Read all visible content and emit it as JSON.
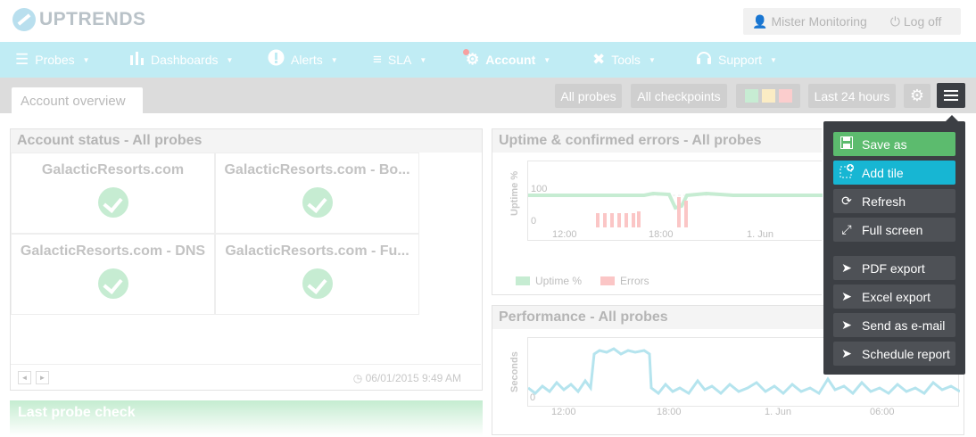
{
  "app": {
    "brand": "UPTRENDS"
  },
  "user": {
    "name": "Mister Monitoring",
    "logoff": "Log off"
  },
  "nav": [
    {
      "label": "Probes",
      "icon": "list-icon"
    },
    {
      "label": "Dashboards",
      "icon": "bar-chart-icon"
    },
    {
      "label": "Alerts",
      "icon": "alert-icon"
    },
    {
      "label": "SLA",
      "icon": "checklist-icon"
    },
    {
      "label": "Account",
      "icon": "gear-icon"
    },
    {
      "label": "Tools",
      "icon": "tools-icon"
    },
    {
      "label": "Support",
      "icon": "headset-icon"
    }
  ],
  "toolbar": {
    "tab": "Account overview",
    "all_probes": "All probes",
    "all_checkpoints": "All checkpoints",
    "range": "Last 24 hours",
    "status_colors": [
      "#c7ecd3",
      "#fbecc4",
      "#fbcdcd"
    ]
  },
  "account_status": {
    "title": "Account status - All probes",
    "cells": [
      {
        "name": "GalacticResorts.com"
      },
      {
        "name": "GalacticResorts.com - Bo..."
      },
      {
        "name": "GalacticResorts.com - DNS"
      },
      {
        "name": "GalacticResorts.com - Fu..."
      }
    ],
    "timestamp": "06/01/2015 9:49 AM",
    "prev": "◄",
    "next": "►"
  },
  "last_probe": {
    "title": "Last probe check"
  },
  "uptime": {
    "title": "Uptime & confirmed errors - All probes",
    "ylabel": "Uptime %",
    "y_ticks": [
      "100",
      "0"
    ],
    "x_ticks": [
      "12:00",
      "18:00",
      "1. Jun"
    ],
    "legend": [
      "Uptime %",
      "Errors"
    ],
    "colors": {
      "uptime": "#c6ecd2",
      "errors": "#fbc6c6"
    }
  },
  "performance": {
    "title": "Performance - All probes",
    "ylabel": "Seconds",
    "y_ticks": [
      "0"
    ],
    "x_ticks": [
      "12:00",
      "18:00",
      "1. Jun",
      "06:00"
    ],
    "color": "#b5e4ee"
  },
  "menu": {
    "items": [
      {
        "label": "Save as",
        "icon": "save-icon",
        "color": "#5cbb6e"
      },
      {
        "label": "Add tile",
        "icon": "add-tile-icon",
        "color": "#17b6d3"
      },
      {
        "label": "Refresh",
        "icon": "refresh-icon"
      },
      {
        "label": "Full screen",
        "icon": "fullscreen-icon"
      },
      {
        "label": "PDF export",
        "icon": "send-icon"
      },
      {
        "label": "Excel export",
        "icon": "send-icon"
      },
      {
        "label": "Send as e-mail",
        "icon": "send-icon"
      },
      {
        "label": "Schedule report",
        "icon": "send-icon"
      }
    ]
  }
}
